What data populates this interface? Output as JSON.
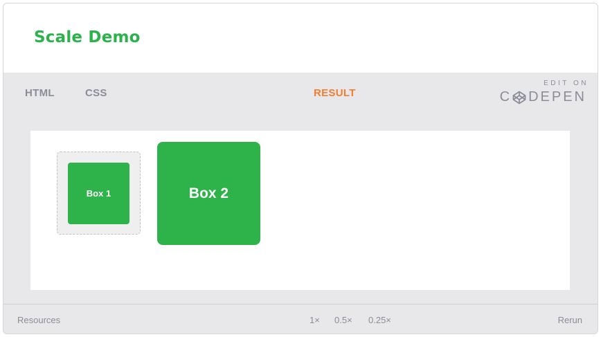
{
  "header": {
    "title": "Scale Demo"
  },
  "tabs": {
    "html": "HTML",
    "css": "CSS",
    "result": "RESULT"
  },
  "codepen": {
    "edit_on": "EDIT ON",
    "brand": "DEPEN",
    "brand_prefix": "C"
  },
  "result": {
    "box1_label": "Box 1",
    "box2_label": "Box 2"
  },
  "footer": {
    "resources": "Resources",
    "zoom_options": [
      "1×",
      "0.5×",
      "0.25×"
    ],
    "rerun": "Rerun"
  },
  "colors": {
    "accent_green": "#2cb24a",
    "active_tab": "#f37d2e",
    "muted": "#8a8c99"
  }
}
